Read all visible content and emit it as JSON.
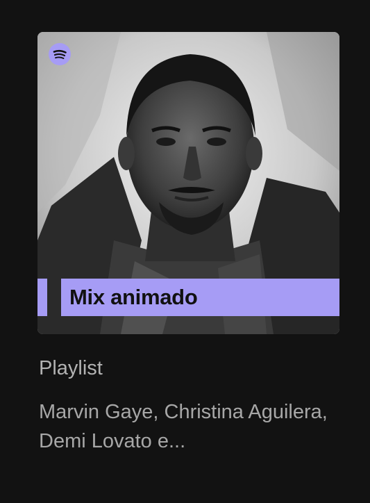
{
  "card": {
    "cover_title": "Mix animado",
    "type": "Playlist",
    "description": "Marvin Gaye, Christina Aguilera, Demi Lovato e..."
  },
  "icons": {
    "logo": "spotify-logo-icon"
  },
  "colors": {
    "background": "#121212",
    "accent": "#a69cf5",
    "secondary_text": "#b3b3b3"
  }
}
